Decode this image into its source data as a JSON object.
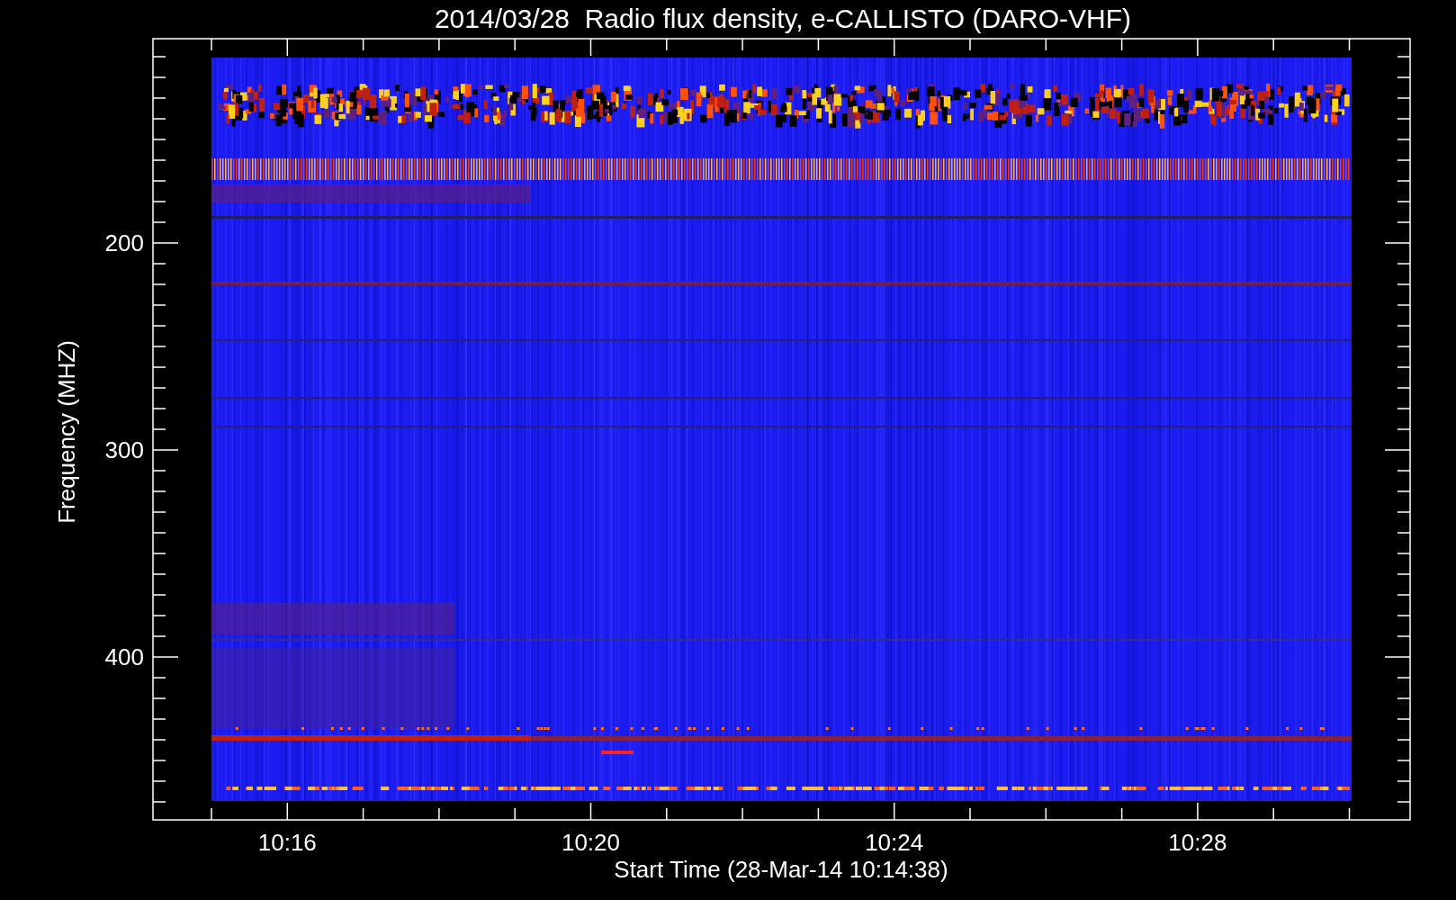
{
  "title": "2014/03/28  Radio flux density, e-CALLISTO (DARO-VHF)",
  "y_axis": {
    "title": "Frequency (MHZ)",
    "tick_labels": [
      "200",
      "300",
      "400"
    ]
  },
  "x_axis": {
    "title": "Start Time (28-Mar-14 10:14:38)",
    "tick_labels": [
      "10:16",
      "10:20",
      "10:24",
      "10:28"
    ]
  }
}
